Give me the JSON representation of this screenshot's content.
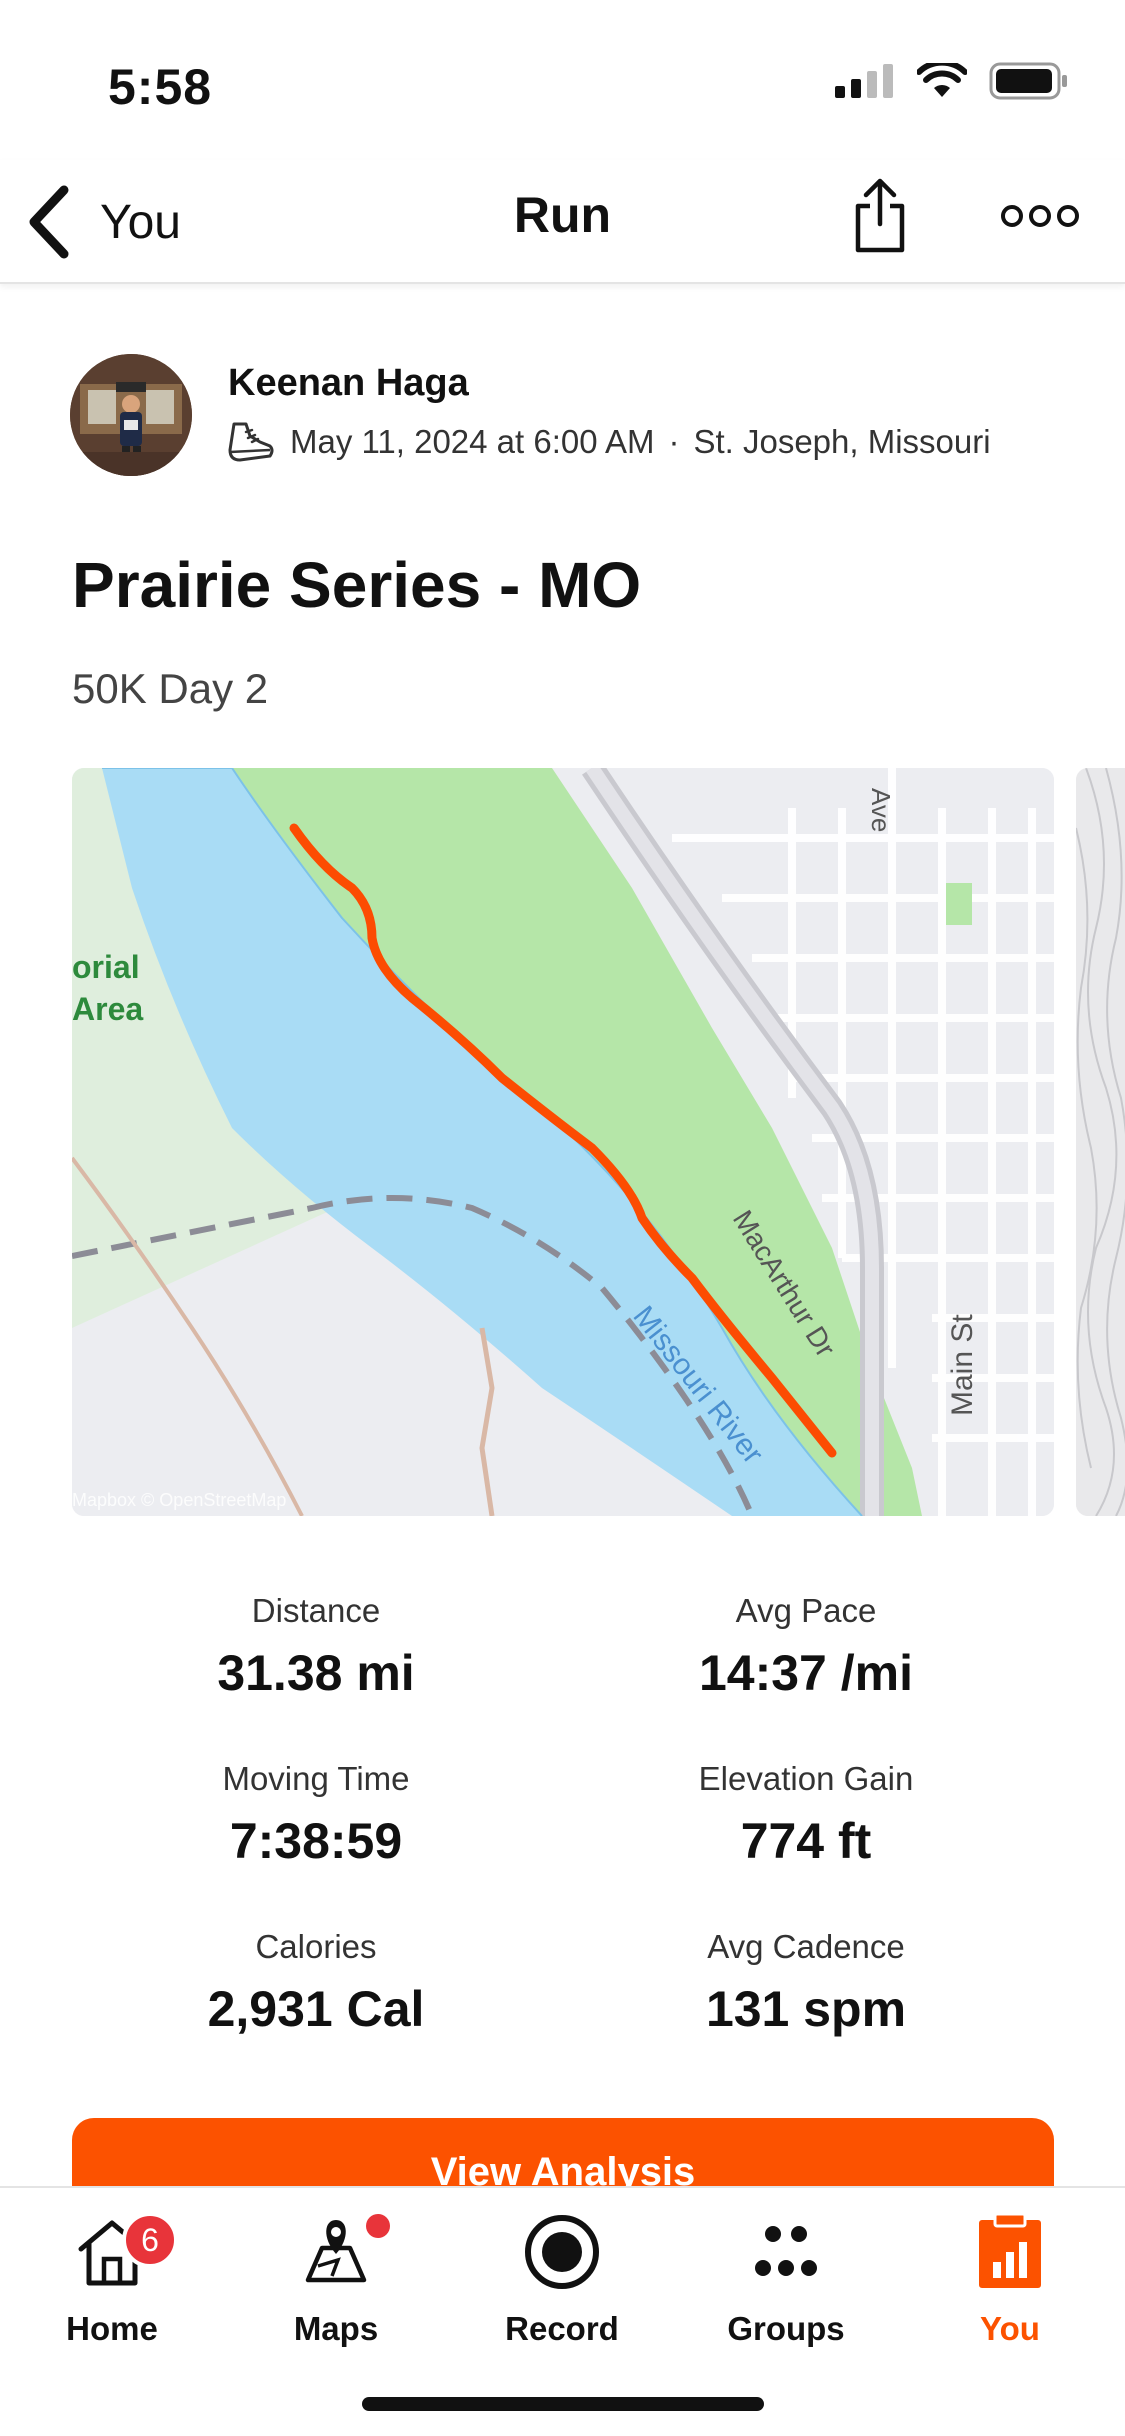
{
  "status": {
    "time": "5:58"
  },
  "nav": {
    "back_label": "You",
    "title": "Run"
  },
  "athlete": {
    "name": "Keenan Haga",
    "date": "May 11, 2024 at 6:00 AM",
    "separator": "·",
    "location": "St. Joseph, Missouri"
  },
  "activity": {
    "title": "Prairie Series - MO",
    "description": "50K Day 2"
  },
  "map": {
    "labels": {
      "area_line1": "orial",
      "area_line2": "Area",
      "river": "Missouri River",
      "road1": "MacArthur Dr",
      "road2": "Main St",
      "road3": "Ave",
      "attribution": "Mapbox © OpenStreetMap"
    },
    "route_color": "#fc4c02"
  },
  "stats": [
    {
      "label": "Distance",
      "value": "31.38 mi"
    },
    {
      "label": "Avg Pace",
      "value": "14:37 /mi"
    },
    {
      "label": "Moving Time",
      "value": "7:38:59"
    },
    {
      "label": "Elevation Gain",
      "value": "774 ft"
    },
    {
      "label": "Calories",
      "value": "2,931 Cal"
    },
    {
      "label": "Avg Cadence",
      "value": "131 spm"
    }
  ],
  "button": {
    "label": "View Analysis"
  },
  "tabs": [
    {
      "label": "Home",
      "icon": "home-icon",
      "badge": "6"
    },
    {
      "label": "Maps",
      "icon": "maps-icon"
    },
    {
      "label": "Record",
      "icon": "record-icon"
    },
    {
      "label": "Groups",
      "icon": "groups-icon"
    },
    {
      "label": "You",
      "icon": "you-icon"
    }
  ],
  "colors": {
    "accent": "#fc5200",
    "badge": "#e8343a"
  }
}
